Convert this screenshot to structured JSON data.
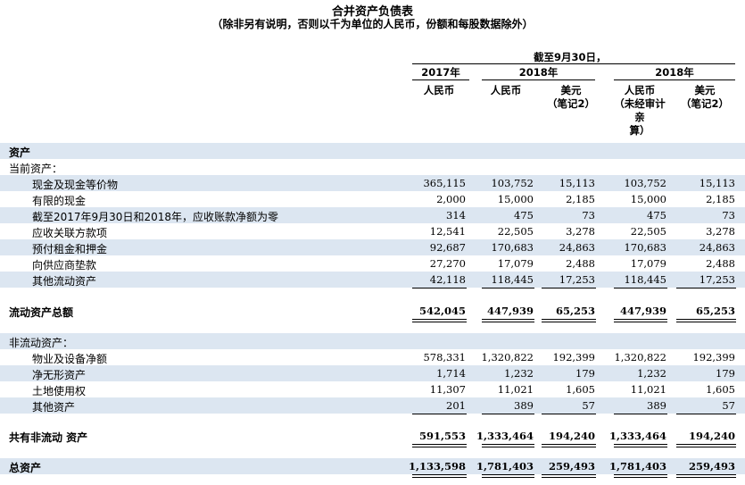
{
  "title": "合并资产负债表",
  "subtitle": "（除非另有说明，否则以千为单位的人民币，份额和每股数据除外）",
  "header": {
    "as_of": "截至9月30日，",
    "years": [
      "2017年",
      "2018年",
      "2018年"
    ],
    "cols": [
      [
        "人民币"
      ],
      [
        "人民币"
      ],
      [
        "美元",
        "（笔记2）"
      ],
      [
        "人民币",
        "（未经审计",
        "亲",
        "算）"
      ],
      [
        "美元",
        "（笔记2）"
      ]
    ]
  },
  "sections": {
    "assets": "资产",
    "current": "当前资产：",
    "noncurrent": "非流动资产："
  },
  "current_rows": [
    {
      "label": "现金及现金等价物",
      "values": [
        "365,115",
        "103,752",
        "15,113",
        "103,752",
        "15,113"
      ]
    },
    {
      "label": "有限的现金",
      "values": [
        "2,000",
        "15,000",
        "2,185",
        "15,000",
        "2,185"
      ]
    },
    {
      "label": "截至2017年9月30日和2018年，应收账款净额为零",
      "values": [
        "314",
        "475",
        "73",
        "475",
        "73"
      ]
    },
    {
      "label": "应收关联方款项",
      "values": [
        "12,541",
        "22,505",
        "3,278",
        "22,505",
        "3,278"
      ]
    },
    {
      "label": "预付租金和押金",
      "values": [
        "92,687",
        "170,683",
        "24,863",
        "170,683",
        "24,863"
      ]
    },
    {
      "label": "向供应商垫款",
      "values": [
        "27,270",
        "17,079",
        "2,488",
        "17,079",
        "2,488"
      ]
    },
    {
      "label": "其他流动资产",
      "values": [
        "42,118",
        "118,445",
        "17,253",
        "118,445",
        "17,253"
      ]
    }
  ],
  "total_current": {
    "label": "流动资产总额",
    "values": [
      "542,045",
      "447,939",
      "65,253",
      "447,939",
      "65,253"
    ]
  },
  "noncurrent_rows": [
    {
      "label": "物业及设备净额",
      "values": [
        "578,331",
        "1,320,822",
        "192,399",
        "1,320,822",
        "192,399"
      ]
    },
    {
      "label": "净无形资产",
      "values": [
        "1,714",
        "1,232",
        "179",
        "1,232",
        "179"
      ]
    },
    {
      "label": "土地使用权",
      "values": [
        "11,307",
        "11,021",
        "1,605",
        "11,021",
        "1,605"
      ]
    },
    {
      "label": "其他资产",
      "values": [
        "201",
        "389",
        "57",
        "389",
        "57"
      ]
    }
  ],
  "total_noncurrent": {
    "label": "共有非流动 资产",
    "values": [
      "591,553",
      "1,333,464",
      "194,240",
      "1,333,464",
      "194,240"
    ]
  },
  "total_assets": {
    "label": "总资产",
    "values": [
      "1,133,598",
      "1,781,403",
      "259,493",
      "1,781,403",
      "259,493"
    ]
  },
  "colors": {
    "row_shade": "#dce6f1"
  }
}
